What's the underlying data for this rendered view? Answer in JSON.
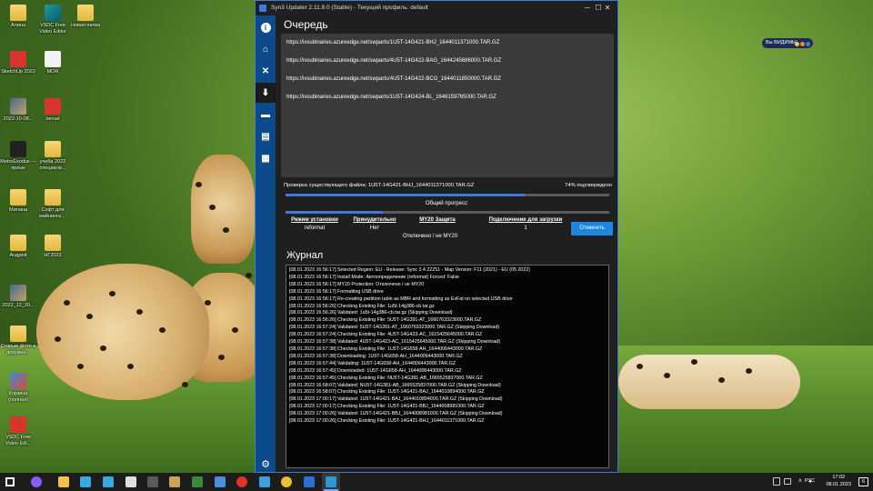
{
  "desktop": {
    "icons": [
      {
        "label": "Алина",
        "kind": "folder"
      },
      {
        "label": "VSDC Free Video Editor",
        "kind": "vsdc"
      },
      {
        "label": "Новая папка",
        "kind": "folder"
      },
      {
        "label": "SketchUp 2020",
        "kind": "red"
      },
      {
        "label": "MOR",
        "kind": "doc"
      },
      {
        "label": "2022-10-08...",
        "kind": "photo"
      },
      {
        "label": "песни",
        "kind": "red"
      },
      {
        "label": "MetroExodus — ярлык",
        "kind": "dark"
      },
      {
        "label": "учеба 2022 специали...",
        "kind": "folder"
      },
      {
        "label": "Милана",
        "kind": "folder"
      },
      {
        "label": "Софт для майнинга ...",
        "kind": "folder"
      },
      {
        "label": "Андрей",
        "kind": "folder"
      },
      {
        "label": "НГ2023",
        "kind": "folder"
      },
      {
        "label": "2022_12_20...",
        "kind": "photo"
      },
      {
        "label": "Старые фото и докумен...",
        "kind": "folder"
      },
      {
        "label": "Корзина (полная)",
        "kind": "winbin"
      },
      {
        "label": "VSDC Free Video Edi...",
        "kind": "red"
      }
    ],
    "visible_pill": "Вы ВИДИМЫ"
  },
  "window": {
    "title": "Syn3 Updater 2.11.8.0 (Stable) - Текущий профиль: default",
    "controls": {
      "minimize": "─",
      "maximize": "☐",
      "close": "✕"
    }
  },
  "sidebar": {
    "items": [
      {
        "name": "info-icon",
        "glyph": "i"
      },
      {
        "name": "home-icon",
        "glyph": "⌂"
      },
      {
        "name": "tools-icon",
        "glyph": "✕"
      },
      {
        "name": "download-icon",
        "glyph": "⬇",
        "active": true
      },
      {
        "name": "car-icon",
        "glyph": "▬"
      },
      {
        "name": "document-icon",
        "glyph": "▤"
      },
      {
        "name": "logs-icon",
        "glyph": "▦"
      }
    ],
    "settings_glyph": "⚙"
  },
  "queue": {
    "title": "Очередь",
    "items": [
      "https://ivsubinaries.azureedge.net/swparts/1U5T-14G421-BHJ_1644011371000.TAR.GZ",
      "https://ivsubinaries.azureedge.net/swparts/4U5T-14G422-BAG_1644245686000.TAR.GZ",
      "https://ivsubinaries.azureedge.net/swparts/4U5T-14G422-BCG_1644011850000.TAR.GZ",
      "https://ivsubinaries.azureedge.net/swparts/1U5T-14G424-BL_1646159765000.TAR.GZ"
    ]
  },
  "progress": {
    "check_text": "Проверка существующего файла: 1U5T-14G421-BHJ_1644011371000.TAR.GZ",
    "check_percent_text": "74% подтверждено",
    "file_progress": 0.74,
    "overall_label": "Общий прогресс",
    "overall_progress": 0.3
  },
  "info": {
    "install_mode": {
      "label": "Режим установки",
      "value": "reformat"
    },
    "forced": {
      "label": "Принудительно",
      "value": "Нет"
    },
    "my20": {
      "label": "MY20 Защита",
      "value": ""
    },
    "connection": {
      "label": "Подключение для загрузки",
      "value": "1"
    },
    "status_line": "Отключено / не MY20",
    "cancel_label": "Отменить"
  },
  "journal": {
    "title": "Журнал",
    "lines": [
      "[08.01.2023 16:56:17] Selected Region: EU - Release: Sync 3.4.22251 - Map Version: F11 (2021) - EU (05 2022)",
      "[08.01.2023 16:56:17] Install Mode: Автоопределение (reformat) Forced: False",
      "[08.01.2023 16:56:17] MY20 Protection: Отключено / не MY20",
      "[08.01.2023 16:56:17] Formatting USB drive",
      "[08.01.2023 16:56:17] Re-creating partition table as MBR and formatting as ExFat on selected USB drive",
      "[08.01.2023 16:56:26] Checking Existing File: 1u5t-14g386-cb.tar.gz",
      "[08.01.2023 16:56:26] Validated: 1u5t-14g386-cb.tar.gz (Skipping Download)",
      "[08.01.2023 16:56:26] Checking Existing File: 5U5T-14G391-AT_1660763323000.TAR.GZ",
      "[08.01.2023 16:57:24] Validated: 5U5T-14G391-AT_1660763323000.TAR.GZ (Skipping Download)",
      "[08.01.2023 16:57:24] Checking Existing File: 4U5T-14G423-AC_1615425645000.TAR.GZ",
      "[08.01.2023 16:57:38] Validated: 4U5T-14G423-AC_1615425645000.TAR.GZ (Skipping Download)",
      "[08.01.2023 16:57:38] Checking Existing File: 1U5T-14G658-AH_1644006443000.TAR.GZ",
      "[08.01.2023 16:57:38] Downloading: 1U5T-14G658-AH_1644006443000.TAR.GZ",
      "[08.01.2023 16:57:44] Validating: 1U5T-14G658-AH_1644006443000.TAR.GZ",
      "[08.01.2023 16:57:45] Downloaded: 1U5T-14G658-AH_1644006443000.TAR.GZ",
      "[08.01.2023 16:57:45] Checking Existing File: NU5T-14G381-AB_1665525837000.TAR.GZ",
      "[08.01.2023 16:58:07] Validated: NU5T-14G381-AB_1665525837000.TAR.GZ (Skipping Download)",
      "[08.01.2023 16:58:07] Checking Existing File: 1U5T-14G421-BAJ_1644010894000.TAR.GZ",
      "[08.01.2023 17:00:17] Validated: 1U5T-14G421-BAJ_1644010894000.TAR.GZ (Skipping Download)",
      "[08.01.2023 17:00:17] Checking Existing File: 1U5T-14G421-BBJ_1644008981000.TAR.GZ",
      "[08.01.2023 17:00:26] Validated: 1U5T-14G421-BBJ_1644008981000.TAR.GZ (Skipping Download)",
      "[08.01.2023 17:00:26] Checking Existing File: 1U5T-14G421-BHJ_1644011371000.TAR.GZ"
    ]
  },
  "taskbar": {
    "apps": [
      {
        "name": "start-button",
        "color": "#ffffff"
      },
      {
        "name": "cortana-icon",
        "color": "#8a5cf6"
      },
      {
        "name": "explorer-icon",
        "color": "#f2c14e"
      },
      {
        "name": "app-icon-1",
        "color": "#3aa9e0"
      },
      {
        "name": "app-icon-2",
        "color": "#3aa9e0"
      },
      {
        "name": "app-icon-3",
        "color": "#e0e0e0"
      },
      {
        "name": "app-icon-4",
        "color": "#5a5a5a"
      },
      {
        "name": "app-icon-5",
        "color": "#c9a35a"
      },
      {
        "name": "app-icon-6",
        "color": "#3a8a3a"
      },
      {
        "name": "app-icon-7",
        "color": "#4a90d9"
      },
      {
        "name": "opera-icon",
        "color": "#e0312b"
      },
      {
        "name": "app-icon-8",
        "color": "#3aa0e0"
      },
      {
        "name": "chrome-icon",
        "color": "#e8c030"
      },
      {
        "name": "shield-icon",
        "color": "#2d6fd6"
      },
      {
        "name": "syn3-updater-taskbar-icon",
        "color": "#2a9ad6",
        "active": true
      }
    ],
    "lang": "РУС",
    "time": "17:02",
    "date": "08.01.2023",
    "notifications_count": "6"
  }
}
